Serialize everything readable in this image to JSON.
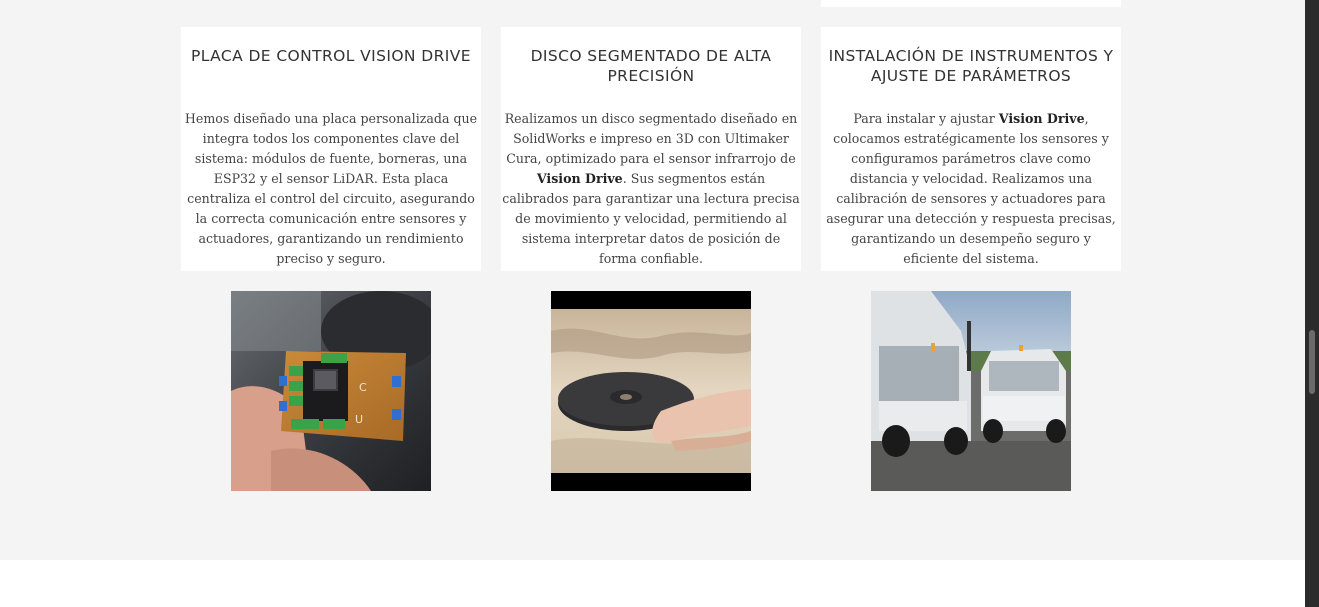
{
  "cards": [
    {
      "title": "PLACA DE CONTROL VISION DRIVE",
      "text": "Hemos diseñado una placa personalizada que integra todos los componentes clave del sistema: módulos de fuente, borneras, una ESP32 y el sensor LiDAR. Esta placa centraliza el control del circuito, asegurando la correcta comunicación entre sensores y actuadores, garantizando un rendimiento preciso y seguro."
    },
    {
      "title": "DISCO SEGMENTADO DE ALTA PRECISIÓN",
      "text_before": "Realizamos un disco segmentado diseñado en SolidWorks e impreso en 3D con Ultimaker Cura, optimizado para el sensor infrarrojo de ",
      "bold": "Vision Drive",
      "text_after": ". Sus segmentos están calibrados para garantizar una lectura precisa de movimiento y velocidad, permitiendo al sistema interpretar datos de posición de forma confiable."
    },
    {
      "title": "INSTALACIÓN DE INSTRUMENTOS Y AJUSTE DE PARÁMETROS",
      "text_before": "Para instalar y ajustar ",
      "bold": "Vision Drive",
      "text_after": ", colocamos estratégicamente los sensores y configuramos parámetros clave como distancia y velocidad. Realizamos una calibración de sensores y actuadores para asegurar una detección y respuesta precisas, garantizando un desempeño seguro y eficiente del sistema."
    }
  ],
  "photos": [
    {
      "name": "control-board-photo",
      "pcb_labels": [
        "C",
        "U"
      ]
    },
    {
      "name": "segmented-disc-photo"
    },
    {
      "name": "golf-carts-photo"
    }
  ]
}
